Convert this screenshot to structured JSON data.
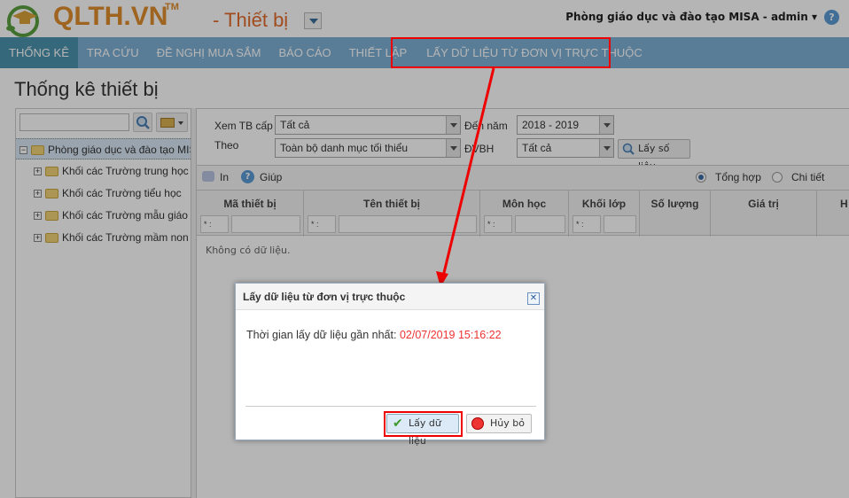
{
  "header": {
    "logo": "QLTH.VN",
    "logo_tm": "TM",
    "module": "- Thiết bị",
    "user": "Phòng giáo dục và đào tạo MISA - admin ▾",
    "help": "?"
  },
  "nav": [
    {
      "label": "THỐNG KÊ",
      "active": true
    },
    {
      "label": "TRA CỨU"
    },
    {
      "label": "ĐỀ NGHỊ MUA SẮM"
    },
    {
      "label": "BÁO CÁO"
    },
    {
      "label": "THIẾT LẬP"
    },
    {
      "label": "LẤY DỮ LIỆU TỪ ĐƠN VỊ TRỰC THUỘC"
    }
  ],
  "page_title": "Thống kê thiết bị",
  "tree": {
    "search_value": "",
    "root": "Phòng giáo dục và đào tạo MISA",
    "children": [
      "Khối các Trường trung học cơ sở",
      "Khối các Trường tiểu học",
      "Khối các Trường mẫu giáo",
      "Khối các Trường mầm non"
    ]
  },
  "filters": {
    "xem_tb_cap_label": "Xem TB cấp",
    "xem_tb_cap": "Tất cả",
    "den_nam_label": "Đến năm",
    "den_nam": "2018 - 2019",
    "theo_label": "Theo",
    "theo": "Toàn bộ danh mục tối thiểu",
    "dvbh_label": "ĐVBH",
    "dvbh": "Tất cả",
    "get_button": "Lấy số liệu"
  },
  "toolbar": {
    "print": "In",
    "help": "Giúp",
    "summary": "Tổng hợp",
    "detail": "Chi tiết"
  },
  "grid": {
    "columns": [
      "Mã thiết bị",
      "Tên thiết bị",
      "Môn học",
      "Khối lớp",
      "Số lượng",
      "Giá trị",
      "H"
    ],
    "filter_op": "* :",
    "empty": "Không có dữ liệu."
  },
  "dialog": {
    "title": "Lấy dữ liệu từ đơn vị trực thuộc",
    "message": "Thời gian lấy dữ liệu gần nhất:",
    "time": "02/07/2019 15:16:22",
    "ok": "Lấy dữ liệu",
    "cancel": "Hủy bỏ",
    "close": "✕"
  },
  "colors": {
    "nav": "#7eb0d5",
    "highlight": "#ee0000",
    "time": "#ee3333"
  }
}
